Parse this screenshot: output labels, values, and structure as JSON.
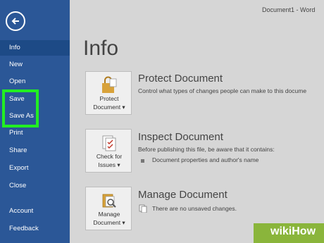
{
  "window": {
    "title": "Document1 - Word"
  },
  "sidebar": {
    "back_label": "Back",
    "items": [
      {
        "label": "Info"
      },
      {
        "label": "New"
      },
      {
        "label": "Open"
      },
      {
        "label": "Save"
      },
      {
        "label": "Save As"
      },
      {
        "label": "Print"
      },
      {
        "label": "Share"
      },
      {
        "label": "Export"
      },
      {
        "label": "Close"
      },
      {
        "label": "Account"
      },
      {
        "label": "Feedback"
      }
    ]
  },
  "main": {
    "title": "Info",
    "sections": [
      {
        "button": {
          "line1": "Protect",
          "line2": "Document ▾"
        },
        "heading": "Protect Document",
        "description": "Control what types of changes people can make to this docume"
      },
      {
        "button": {
          "line1": "Check for",
          "line2": "Issues ▾"
        },
        "heading": "Inspect Document",
        "description": "Before publishing this file, be aware that it contains:",
        "bullet": "Document properties and author's name"
      },
      {
        "button": {
          "line1": "Manage",
          "line2": "Document ▾"
        },
        "heading": "Manage Document",
        "description": "There are no unsaved changes."
      }
    ]
  },
  "watermark": {
    "text": "wikiHow"
  },
  "colors": {
    "sidebar": "#2b5797",
    "highlight": "#22ee22",
    "background": "#d6d6d6"
  }
}
